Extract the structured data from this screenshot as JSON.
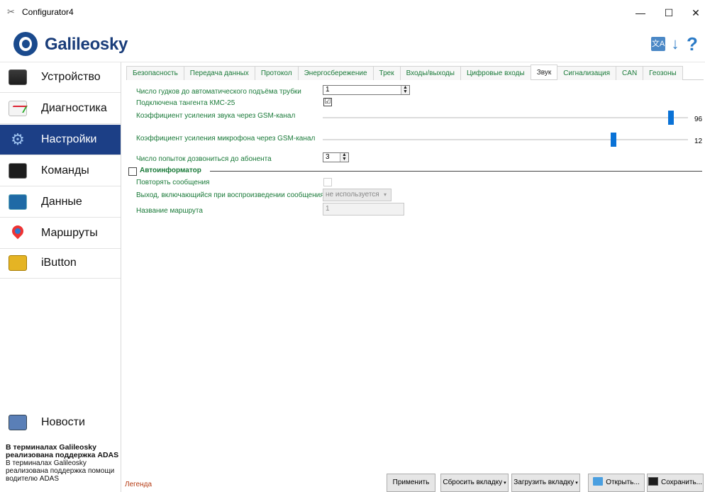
{
  "window": {
    "title": "Configurator4",
    "controls": {
      "minimize": "—",
      "maximize": "☐",
      "close": "✕"
    }
  },
  "header": {
    "logo_text": "Galileosky",
    "icons": [
      "language-icon",
      "download-icon",
      "help-icon"
    ],
    "download_glyph": "↓",
    "help_glyph": "?",
    "lang_glyph": "文A"
  },
  "sidebar": {
    "items": [
      {
        "label": "Устройство",
        "icon": "device-icon"
      },
      {
        "label": "Диагностика",
        "icon": "diagnostics-icon"
      },
      {
        "label": "Настройки",
        "icon": "gear-icon",
        "active": true
      },
      {
        "label": "Команды",
        "icon": "terminal-icon"
      },
      {
        "label": "Данные",
        "icon": "data-icon"
      },
      {
        "label": "Маршруты",
        "icon": "map-pin-icon"
      },
      {
        "label": "iButton",
        "icon": "lock-icon"
      }
    ],
    "news": {
      "label": "Новости",
      "headline": "В терминалах Galileosky реализована поддержка ADAS",
      "body": "В терминалах Galileosky реализована поддержка помощи водителю ADAS"
    },
    "gear_glyph": "⚙"
  },
  "tabs": [
    {
      "label": "Безопасность"
    },
    {
      "label": "Передача данных"
    },
    {
      "label": "Протокол"
    },
    {
      "label": "Энергосбережение"
    },
    {
      "label": "Трек"
    },
    {
      "label": "Входы/выходы"
    },
    {
      "label": "Цифровые входы"
    },
    {
      "label": "Звук",
      "active": true
    },
    {
      "label": "Сигнализация"
    },
    {
      "label": "CAN"
    },
    {
      "label": "Геозоны"
    }
  ],
  "sound": {
    "rings_label": "Число гудков до автоматического подъёма трубки",
    "rings_value": "1",
    "kmc_label": "Подключена тангента КМС-25",
    "kmc_checked": "☑",
    "gsm_speaker_label": "Коэффициент усиления звука через GSM-канал",
    "gsm_speaker_value": 96,
    "gsm_speaker_max": 100,
    "gsm_mic_label": "Коэффициент усиления микрофона через GSM-канал",
    "gsm_mic_value": 12,
    "gsm_mic_max": 15,
    "dial_attempts_label": "Число попыток дозвониться до абонента",
    "dial_attempts_value": "3"
  },
  "autoinformer": {
    "title": "Автоинформатор",
    "repeat_label": "Повторять сообщения",
    "output_label": "Выход, включающийся при воспроизведении сообщения",
    "output_value": "не используется",
    "route_label": "Название маршрута",
    "route_value": "1"
  },
  "footer": {
    "legend": "Легенда",
    "apply": "Применить",
    "reset_tab": "Сбросить вкладку",
    "load_tab": "Загрузить вкладку",
    "open": "Открыть...",
    "save": "Сохранить...",
    "dropdown_glyph": "▾"
  },
  "colors": {
    "accent": "#1c3f86",
    "label_green": "#1a7a39",
    "slider_thumb": "#0a72d6",
    "legend_red": "#b43a12"
  }
}
